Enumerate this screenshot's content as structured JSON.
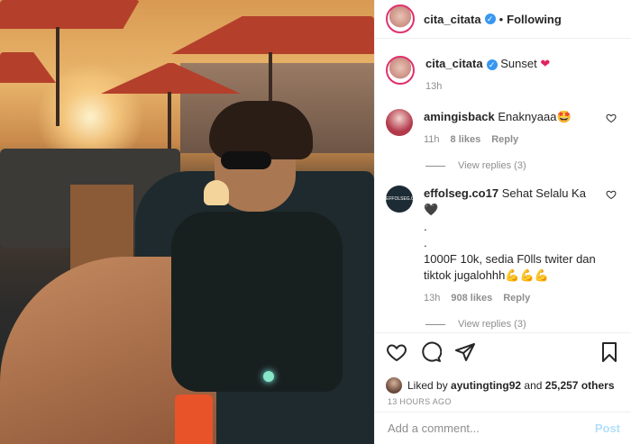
{
  "header": {
    "username": "cita_citata",
    "separator": "•",
    "follow_label": "Following"
  },
  "caption": {
    "username": "cita_citata",
    "text": "Sunset",
    "emoji": "❤",
    "time": "13h"
  },
  "comments": [
    {
      "username": "amingisback",
      "text": "Enaknyaaa",
      "emoji": "🤩",
      "time": "11h",
      "likes": "8 likes",
      "reply_label": "Reply",
      "view_replies": "View replies (3)"
    },
    {
      "username": "effolseg.co17",
      "avatar_text": "EFFOLSEG.CO17",
      "line1": "Sehat Selalu Ka",
      "line1_emoji": "🖤",
      "line2": ".",
      "line3": ".",
      "line4": "1000F 10k, sedia F0lls twiter dan tiktok jugalohhh",
      "line4_emoji": "💪💪💪",
      "time": "13h",
      "likes": "908 likes",
      "reply_label": "Reply",
      "view_replies": "View replies (3)"
    }
  ],
  "likes": {
    "prefix": "Liked by",
    "user": "ayutingting92",
    "and": "and",
    "count": "25,257 others"
  },
  "post_age": "13 HOURS AGO",
  "add_comment": {
    "placeholder": "Add a comment...",
    "post_label": "Post"
  },
  "colors": {
    "verified": "#3897f0",
    "post_disabled": "#b2dffc",
    "story_ring": "#e1306c"
  }
}
